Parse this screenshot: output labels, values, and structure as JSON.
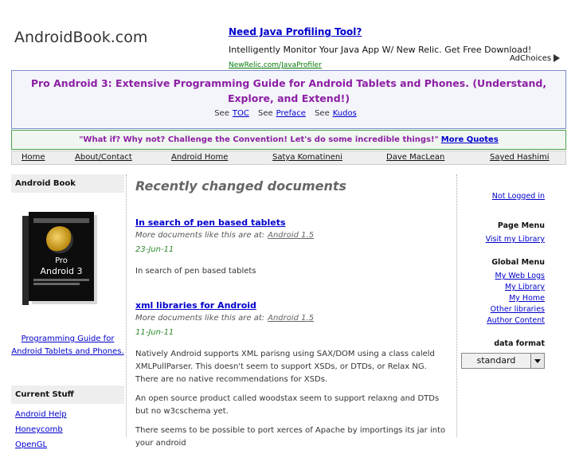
{
  "site": {
    "title": "AndroidBook.com"
  },
  "ad": {
    "title": "Need Java Profiling Tool?",
    "desc": "Intelligently Monitor Your Java App W/ New Relic. Get Free Download!",
    "url": "NewRelic.com/JavaProfiler",
    "choices": "AdChoices"
  },
  "banner": {
    "title": "Pro Android 3: Extensive Programming Guide for Android Tablets and Phones. (Understand, Explore, and Extend!)",
    "links": [
      {
        "prefix": "See",
        "label": "TOC"
      },
      {
        "prefix": "See",
        "label": "Preface"
      },
      {
        "prefix": "See",
        "label": "Kudos"
      }
    ]
  },
  "quote": {
    "text": "\"What if? Why not? Challenge the Convention! Let's do some incredible things!\"",
    "link": "More Quotes"
  },
  "nav": [
    "Home",
    "About/Contact",
    "Android Home",
    "Satya Komatineni",
    "Dave MacLean",
    "Sayed Hashimi"
  ],
  "left": {
    "book_heading": "Android Book",
    "book_cover": {
      "pro": "Pro",
      "android": "Android 3"
    },
    "book_link": "Programming Guide for Android Tablets and Phones.",
    "current_heading": "Current Stuff",
    "current_items": [
      "Android Help",
      "Honeycomb",
      "OpenGL"
    ]
  },
  "main": {
    "heading": "Recently changed documents",
    "docs": [
      {
        "title": "In search of pen based tablets",
        "more_prefix": "More documents like this are at:",
        "more_link": "Android 1.5",
        "date": "23-Jun-11",
        "paragraphs": [
          "In search of pen based tablets"
        ]
      },
      {
        "title": "xml libraries for Android",
        "more_prefix": "More documents like this are at:",
        "more_link": "Android 1.5",
        "date": "11-Jun-11",
        "paragraphs": [
          "Natively Android supports XML parisng using SAX/DOM using a class caleld XMLPullParser. This doesn't seem to support XSDs, or DTDs, or Relax NG. There are no native recommendations for XSDs.",
          "An open source product called woodstax seem to support relaxng and DTDs but no w3cschema yet.",
          "There seems to be possible to port xerces of Apache by importings its jar into your android"
        ]
      }
    ]
  },
  "right": {
    "login": "Not Logged in",
    "page_menu_heading": "Page Menu",
    "page_menu": [
      "Visit my Library"
    ],
    "global_menu_heading": "Global Menu",
    "global_menu": [
      "My Web Logs",
      "My Library",
      "My Home",
      "Other libraries",
      "Author Content"
    ],
    "format_label": "data format",
    "format_value": "standard"
  }
}
